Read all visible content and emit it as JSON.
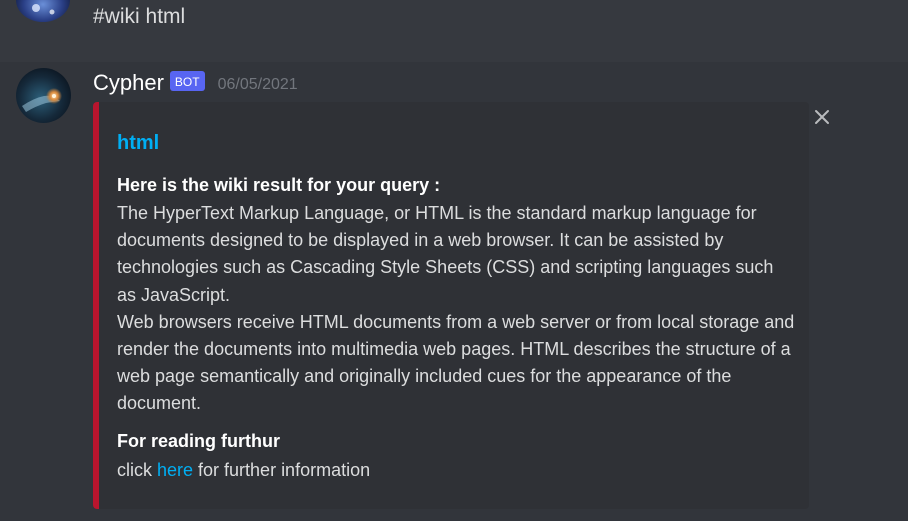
{
  "previous_message": {
    "content": "#wiki html"
  },
  "bot_message": {
    "username": "Cypher",
    "bot_tag": "BOT",
    "timestamp": "06/05/2021",
    "embed": {
      "accent_color": "#b8152e",
      "title": "html",
      "fields": [
        {
          "name": "Here is the wiki result for your query :",
          "paragraphs": [
            "The HyperText Markup Language, or HTML is the standard markup language for documents designed to be displayed in a web browser. It can be assisted by technologies such as Cascading Style Sheets (CSS) and scripting languages such as JavaScript.",
            "Web browsers receive HTML documents from a web server or from local storage and render the documents into multimedia web pages. HTML describes the structure of a web page semantically and originally included cues for the appearance of the document."
          ]
        },
        {
          "name": "For reading furthur",
          "value_prefix": "click ",
          "link_text": "here",
          "value_suffix": " for further information"
        }
      ]
    }
  },
  "icons": {
    "close": "close-icon",
    "previous_avatar": "avatar",
    "bot_avatar": "bot-avatar"
  },
  "colors": {
    "background": "#36393f",
    "message_hover": "#32353b",
    "embed_background": "#2f3136",
    "link": "#00aff4",
    "bot_tag": "#5865f2"
  }
}
